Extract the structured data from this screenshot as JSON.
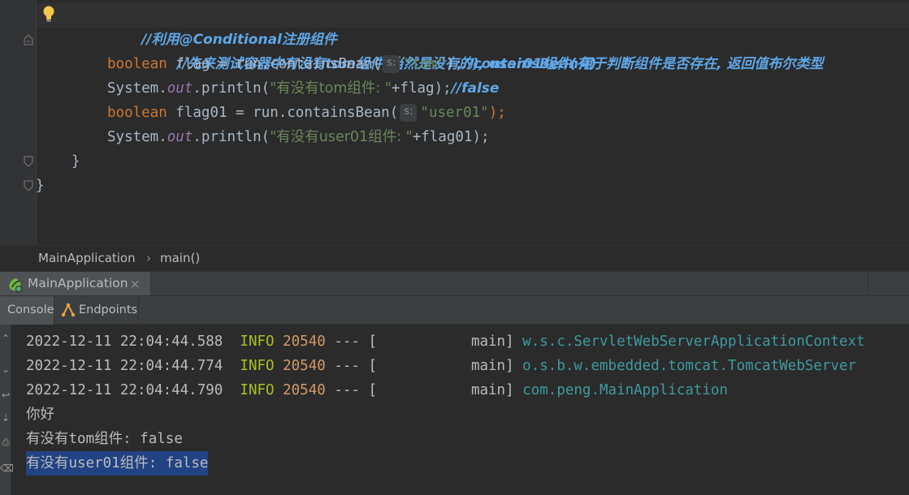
{
  "editor": {
    "lines": [
      {
        "comment": "//利用@Conditional注册组件"
      },
      {
        "comment": "//先来测试容器中有没有tom组件(当然是没有的), user01组件(有)"
      },
      {
        "type_kw": "boolean",
        "var_decl": " flag = run.containsBean(",
        "hint": "s:",
        "string": "\"tom\"",
        "tail": ");",
        "comment": "//containsBean用于判断组件是否存在, 返回值布尔类型"
      },
      {
        "prefix": "System.",
        "field": "out",
        "call": ".println(",
        "string": "\"有没有tom组件: \"",
        "tail": "+flag);",
        "comment": "//false"
      },
      {
        "type_kw": "boolean",
        "var_decl": " flag01 = run.containsBean(",
        "hint": "s:",
        "string": "\"user01\"",
        "tail": ");"
      },
      {
        "prefix": "System.",
        "field": "out",
        "call": ".println(",
        "string": "\"有没有user01组件: \"",
        "tail": "+flag01);"
      },
      {
        "brace": "}"
      },
      {
        "brace": "}"
      }
    ]
  },
  "breadcrumb": {
    "items": [
      "MainApplication",
      "main()"
    ],
    "separator": "›"
  },
  "run_window": {
    "tab_label": "MainApplication",
    "tab_close": "×",
    "subtabs": [
      "Console",
      "Endpoints"
    ],
    "log": [
      {
        "ts": "2022-12-11 22:04:44.588",
        "level": "INFO",
        "pid": "20540",
        "sep": "--- [",
        "thread": "main]",
        "logger": "w.s.c.ServletWebServerApplicationContext"
      },
      {
        "ts": "2022-12-11 22:04:44.774",
        "level": "INFO",
        "pid": "20540",
        "sep": "--- [",
        "thread": "main]",
        "logger": "o.s.b.w.embedded.tomcat.TomcatWebServer"
      },
      {
        "ts": "2022-12-11 22:04:44.790",
        "level": "INFO",
        "pid": "20540",
        "sep": "--- [",
        "thread": "main]",
        "logger": "com.peng.MainApplication"
      }
    ],
    "output": [
      "你好",
      "有没有tom组件: false",
      "有没有user01组件: false"
    ]
  },
  "colors": {
    "background": "#2b2b2b",
    "keyword": "#cc7832",
    "string": "#6a8759",
    "doc_comment": "#5ea7e8",
    "selection": "#214283",
    "log_info": "#a8c023"
  }
}
